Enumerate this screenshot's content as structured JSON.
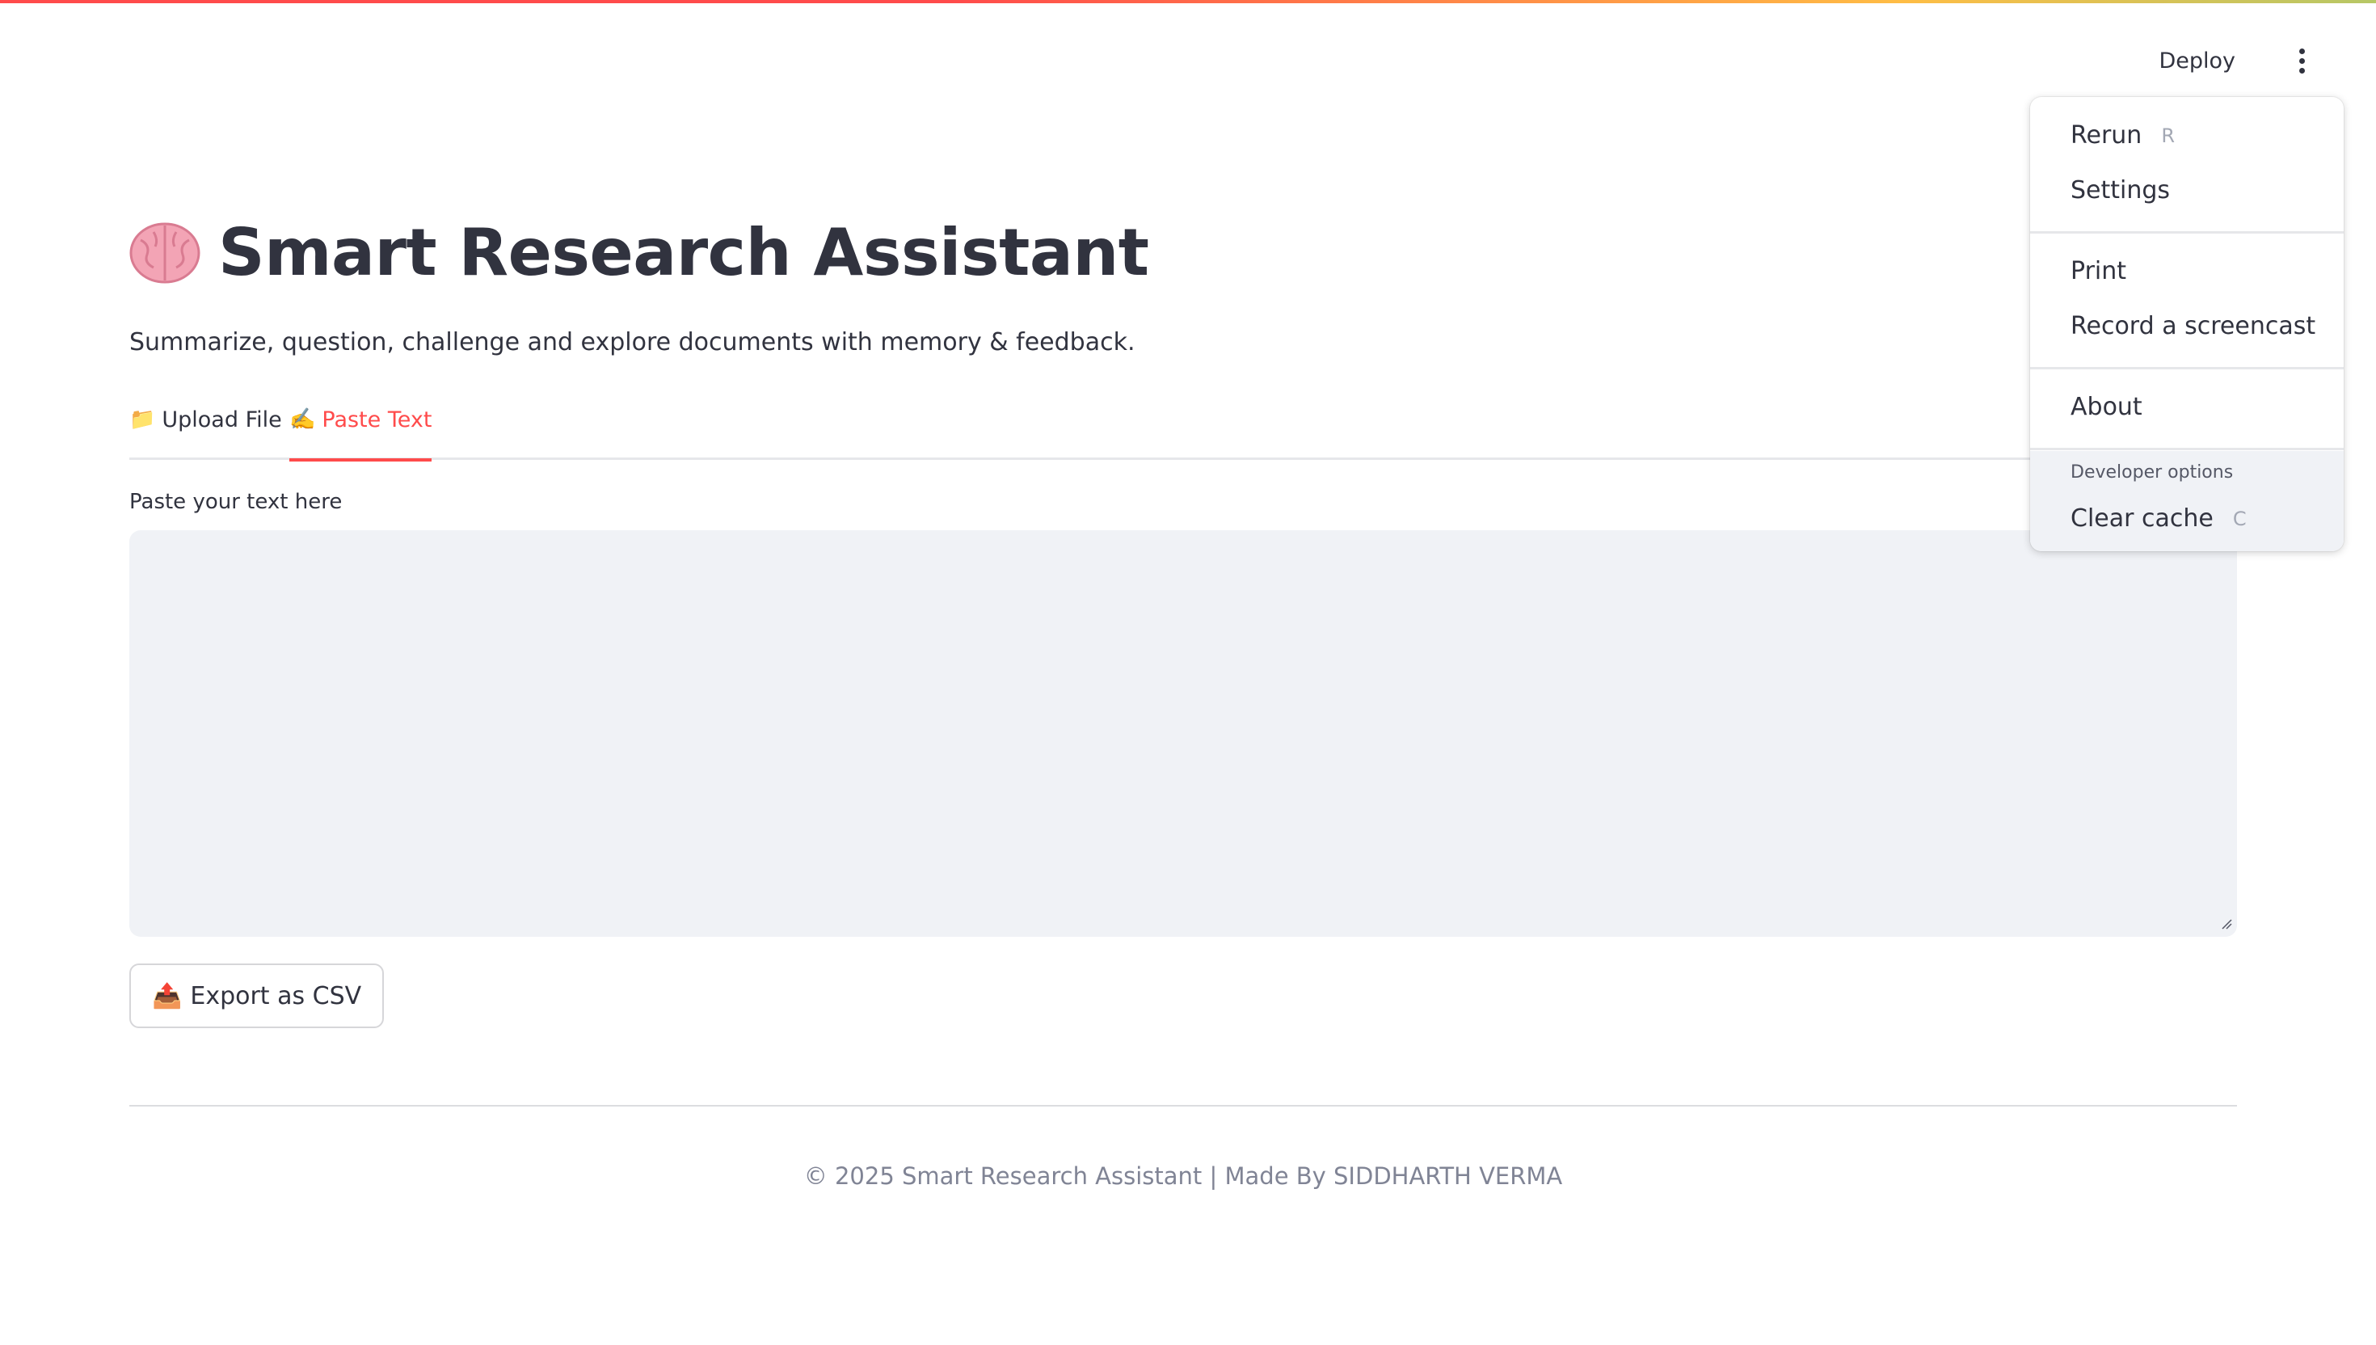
{
  "header": {
    "deploy_label": "Deploy"
  },
  "page": {
    "title_emoji": "🧠",
    "title": "Smart Research Assistant",
    "subtitle": "Summarize, question, challenge and explore documents with memory & feedback."
  },
  "tabs": [
    {
      "emoji": "📁",
      "label": "Upload File",
      "active": false
    },
    {
      "emoji": "✍️",
      "label": "Paste Text",
      "active": true
    }
  ],
  "paste": {
    "label": "Paste your text here",
    "value": ""
  },
  "export": {
    "emoji": "📤",
    "label": "Export as CSV"
  },
  "footer": {
    "text": "© 2025 Smart Research Assistant | Made By SIDDHARTH VERMA"
  },
  "menu": {
    "rerun": {
      "label": "Rerun",
      "shortcut": "R"
    },
    "settings": {
      "label": "Settings"
    },
    "print": {
      "label": "Print"
    },
    "record": {
      "label": "Record a screencast"
    },
    "about": {
      "label": "About"
    },
    "developer_options_label": "Developer options",
    "clear_cache": {
      "label": "Clear cache",
      "shortcut": "C"
    }
  },
  "colors": {
    "accent": "#ff4b4b",
    "text": "#31333f",
    "input_bg": "#f0f2f6"
  }
}
